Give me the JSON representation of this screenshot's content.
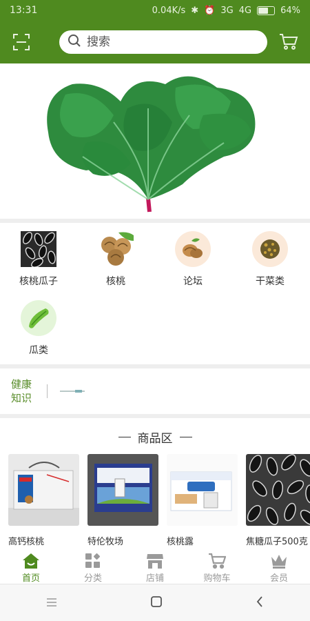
{
  "status_bar": {
    "time": "13:31",
    "network_speed": "0.04K/s",
    "signal_1": "3G",
    "signal_2": "4G",
    "battery": "64%",
    "battery_level": 0.64
  },
  "search": {
    "placeholder": "搜索"
  },
  "icons": {
    "scan": "scan-icon",
    "search": "search-icon",
    "cart": "cart-icon"
  },
  "categories": [
    {
      "label": "核桃瓜子",
      "icon": "sunflower-seeds-image"
    },
    {
      "label": "核桃",
      "icon": "walnut-image"
    },
    {
      "label": "论坛",
      "icon": "forum-walnut-icon"
    },
    {
      "label": "干菜类",
      "icon": "dried-vegetable-icon"
    },
    {
      "label": "瓜类",
      "icon": "melon-icon"
    }
  ],
  "health": {
    "title_line1": "健康",
    "title_line2": "知识"
  },
  "products_section": {
    "title": "商品区"
  },
  "products": [
    {
      "name": "高钙核桃"
    },
    {
      "name": "特伦牧场"
    },
    {
      "name": "核桃露"
    },
    {
      "name": "焦糖瓜子500克"
    }
  ],
  "tabs": [
    {
      "label": "首页",
      "icon": "home-icon",
      "active": true
    },
    {
      "label": "分类",
      "icon": "category-icon",
      "active": false
    },
    {
      "label": "店铺",
      "icon": "store-icon",
      "active": false
    },
    {
      "label": "购物车",
      "icon": "cart-icon",
      "active": false
    },
    {
      "label": "会员",
      "icon": "crown-icon",
      "active": false
    }
  ],
  "colors": {
    "brand": "#4f8a1f",
    "active_tab": "#4f8a1f",
    "health_title": "#5a8d2b",
    "tab_inactive": "#9a9a9a"
  }
}
